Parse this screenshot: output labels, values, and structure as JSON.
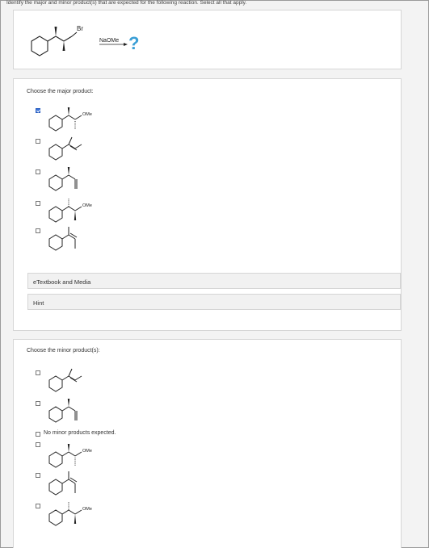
{
  "question": "Identify the major and minor product(s) that are expected for the following reaction. Select all that apply.",
  "reaction": {
    "substituent_label": "Br",
    "reagent_label": "NaOMe",
    "unknown_label": "?"
  },
  "major_section": {
    "title": "Choose the major product:",
    "options": [
      {
        "checked": true,
        "label": "OMe"
      },
      {
        "checked": false,
        "label": ""
      },
      {
        "checked": false,
        "label": ""
      },
      {
        "checked": false,
        "label": "OMe"
      },
      {
        "checked": false,
        "label": ""
      }
    ],
    "etextbook_label": "eTextbook and Media",
    "hint_label": "Hint"
  },
  "minor_section": {
    "title": "Choose the minor product(s):",
    "options": [
      {
        "checked": false,
        "label": ""
      },
      {
        "checked": false,
        "label": ""
      },
      {
        "checked": false,
        "label": "No minor products expected."
      },
      {
        "checked": false,
        "label": "OMe"
      },
      {
        "checked": false,
        "label": ""
      },
      {
        "checked": false,
        "label": "OMe"
      }
    ]
  },
  "colors": {
    "accent": "#3b9fd6",
    "checkbox_checked": "#3b73d9"
  }
}
